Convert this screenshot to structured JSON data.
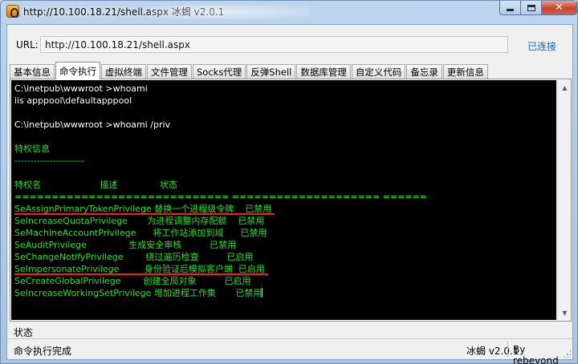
{
  "window": {
    "title": "http://10.100.18.21/shell.aspx    冰蝎 v2.0.1",
    "minimize_icon": "minimize-icon",
    "maximize_icon": "maximize-icon",
    "close_icon": "close-icon",
    "close_color": "#c7422c"
  },
  "url_bar": {
    "label": "URL:",
    "value": "http://10.100.18.21/shell.aspx",
    "status": "已连接",
    "status_color": "#1565d8"
  },
  "tabs": [
    {
      "label": "基本信息",
      "active": false
    },
    {
      "label": "命令执行",
      "active": true
    },
    {
      "label": "虚拟终端",
      "active": false
    },
    {
      "label": "文件管理",
      "active": false
    },
    {
      "label": "Socks代理",
      "active": false
    },
    {
      "label": "反弹Shell",
      "active": false
    },
    {
      "label": "数据库管理",
      "active": false
    },
    {
      "label": "自定义代码",
      "active": false
    },
    {
      "label": "备忘录",
      "active": false
    },
    {
      "label": "更新信息",
      "active": false
    }
  ],
  "console": {
    "background": "#000000",
    "text_color_white": "#ffffff",
    "text_color_green": "#20e020",
    "highlight_color": "#ff1a1a",
    "lines": [
      {
        "text": "C:\\inetpub\\wwwroot >whoami",
        "color": "white"
      },
      {
        "text": "iis apppool\\defaultapppool",
        "color": "white"
      },
      {
        "text": "",
        "color": "white"
      },
      {
        "text": "C:\\inetpub\\wwwroot >whoami /priv",
        "color": "white"
      },
      {
        "text": "",
        "color": "white"
      },
      {
        "text": "特权信息",
        "color": "green"
      },
      {
        "text": "----------------------",
        "color": "green"
      },
      {
        "text": "",
        "color": "green"
      },
      {
        "text": "特权名                     描述               状态",
        "color": "green"
      },
      {
        "text": "============================= ==================== ======",
        "color": "green"
      },
      {
        "text": "SeAssignPrimaryTokenPrivilege 替换一个进程级令牌    已禁用",
        "color": "green",
        "highlight": true
      },
      {
        "text": "SeIncreaseQuotaPrivilege       为进程调整内存配额    已禁用",
        "color": "green"
      },
      {
        "text": "SeMachineAccountPrivilege      将工作站添加到域      已禁用",
        "color": "green"
      },
      {
        "text": "SeAuditPrivilege               生成安全审核          已禁用",
        "color": "green"
      },
      {
        "text": "SeChangeNotifyPrivilege        绕过遍历检查          已启用",
        "color": "green"
      },
      {
        "text": "SeImpersonatePrivilege         身份验证后模拟客户端  已启用",
        "color": "green",
        "highlight": true
      },
      {
        "text": "SeCreateGlobalPrivilege        创建全局对象          已启用",
        "color": "green"
      },
      {
        "text": "SeIncreaseWorkingSetPrivilege 增加进程工作集       已禁用",
        "color": "green",
        "cursor": true
      }
    ]
  },
  "status": {
    "label": "状态",
    "message": "命令执行完成",
    "version": "冰蝎 v2.0.1",
    "author": "By rebeyond"
  }
}
